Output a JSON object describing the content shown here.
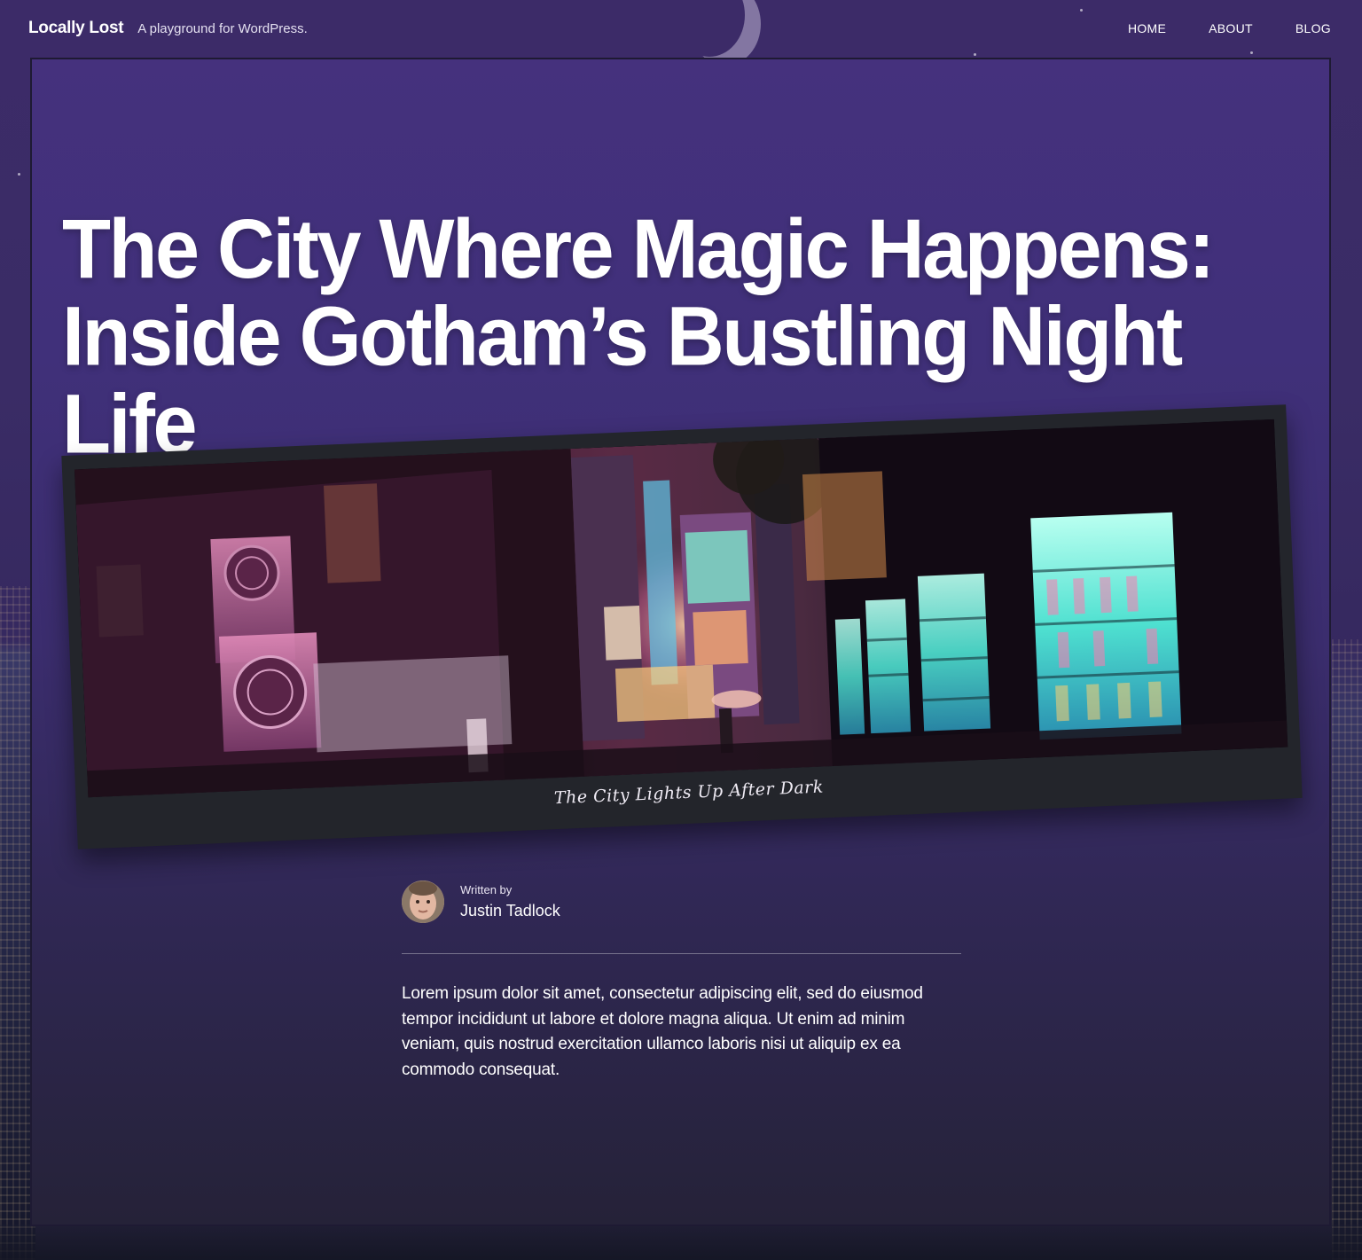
{
  "header": {
    "site_title": "Locally Lost",
    "tagline": "A playground for WordPress.",
    "nav": [
      {
        "label": "HOME"
      },
      {
        "label": "ABOUT"
      },
      {
        "label": "BLOG"
      }
    ]
  },
  "post": {
    "title": "The City Where Magic Happens: Inside Gotham’s Bustling Night Life",
    "featured_image": {
      "caption": "The City Lights Up After Dark"
    },
    "byline": {
      "label": "Written by",
      "author": "Justin Tadlock"
    },
    "body": "Lorem ipsum dolor sit amet, consectetur adipiscing elit, sed do eiusmod tempor incididunt ut labore et dolore magna aliqua. Ut enim ad minim veniam, quis nostrud exercitation ullamco laboris nisi ut aliquip ex ea commodo consequat."
  },
  "colors": {
    "background_top": "#3c2b68",
    "background_bottom": "#1f1d33",
    "frame_border": "#1e1a33",
    "card_background": "#23252b"
  }
}
